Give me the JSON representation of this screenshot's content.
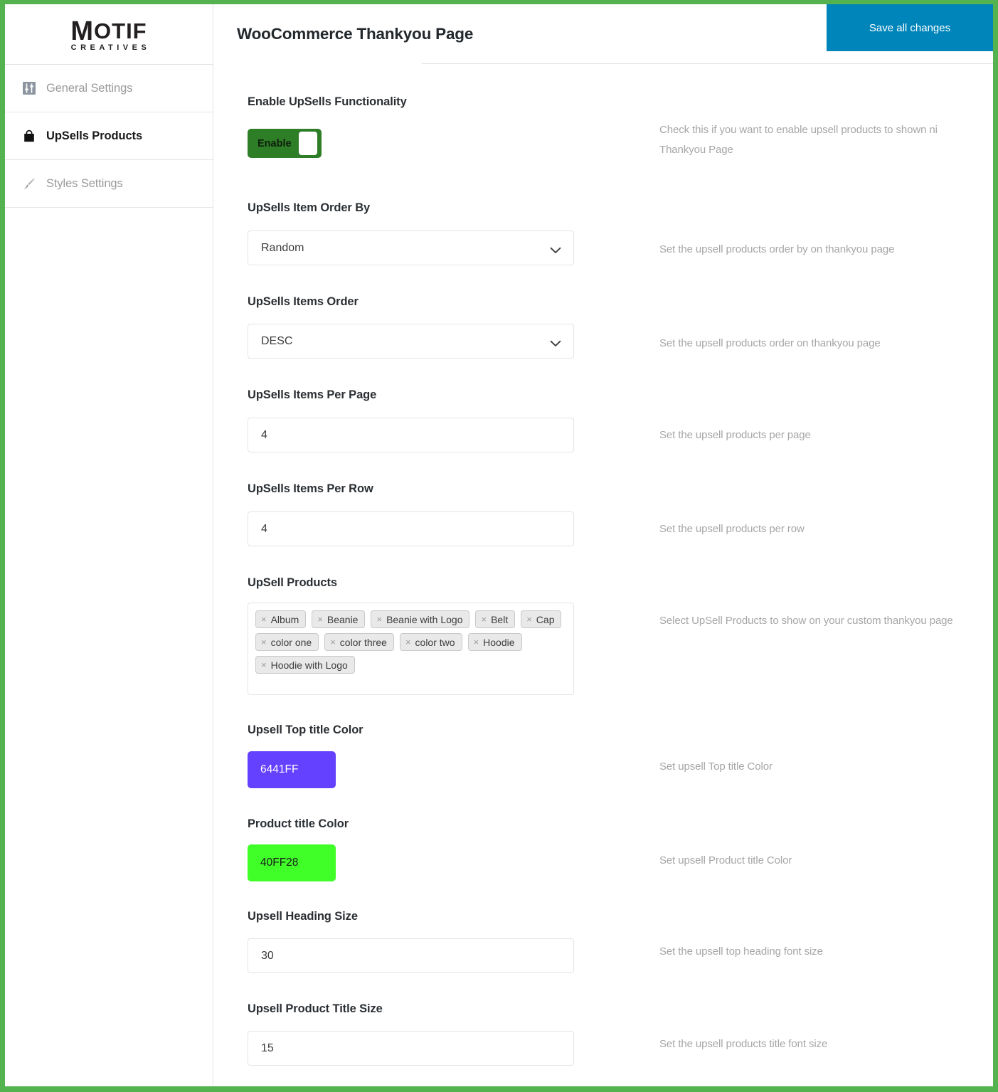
{
  "brand": {
    "logo_main_initial": "M",
    "logo_main_rest": "OTIF",
    "logo_sub": "CREATIVES"
  },
  "header": {
    "title": "WooCommerce Thankyou Page",
    "save_label": "Save all changes",
    "save_color": "#0085ba"
  },
  "theme": {
    "frame_green": "#55b34f",
    "toggle_green": "#2e7d27"
  },
  "sidebar": {
    "items": [
      {
        "label": "General Settings",
        "icon": "sliders-icon",
        "active": false
      },
      {
        "label": "UpSells Products",
        "icon": "shopping-bag-icon",
        "active": true
      },
      {
        "label": "Styles Settings",
        "icon": "paintbrush-icon",
        "active": false
      }
    ]
  },
  "fields": {
    "enable_upsells": {
      "label": "Enable UpSells Functionality",
      "toggle_label": "Enable",
      "toggle_on": true,
      "description": "Check this if you want to enable upsell products to shown ni Thankyou Page"
    },
    "order_by": {
      "label": "UpSells Item Order By",
      "value": "Random",
      "options": [
        "Random"
      ],
      "description": "Set the upsell products order by on thankyou page"
    },
    "items_order": {
      "label": "UpSells Items Order",
      "value": "DESC",
      "options": [
        "DESC"
      ],
      "description": "Set the upsell products order on thankyou page"
    },
    "items_per_page": {
      "label": "UpSells Items Per Page",
      "value": "4",
      "description": "Set the upsell products per page"
    },
    "items_per_row": {
      "label": "UpSells Items Per Row",
      "value": "4",
      "description": "Set the upsell products per row"
    },
    "upsell_products": {
      "label": "UpSell Products",
      "description": "Select UpSell Products to show on your custom thankyou page",
      "remove_glyph": "×",
      "tags": [
        "Album",
        "Beanie",
        "Beanie with Logo",
        "Belt",
        "Cap",
        "color one",
        "color three",
        "color two",
        "Hoodie",
        "Hoodie with Logo"
      ]
    },
    "top_title_color": {
      "label": "Upsell Top title Color",
      "value": "6441FF",
      "swatch_hex": "#6441FF",
      "text_color": "#ffffff",
      "description": "Set upsell Top title Color"
    },
    "product_title_color": {
      "label": "Product title Color",
      "value": "40FF28",
      "swatch_hex": "#40FF28",
      "text_color": "#1a1a1a",
      "description": "Set upsell Product title Color"
    },
    "heading_size": {
      "label": "Upsell Heading Size",
      "value": "30",
      "description": "Set the upsell top heading font size"
    },
    "product_title_size": {
      "label": "Upsell Product Title Size",
      "value": "15",
      "description": "Set the upsell products title font size"
    }
  }
}
